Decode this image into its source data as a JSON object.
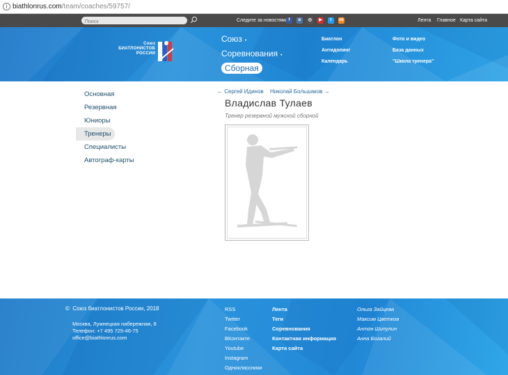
{
  "browser": {
    "url_host": "biathlonrus.com",
    "url_path": "/team/coaches/59757/"
  },
  "topbar": {
    "search_placeholder": "Поиск",
    "follow_label": "Следите за новостями:",
    "social": [
      {
        "icon": "facebook-icon",
        "glyph": "f",
        "color": "#3b5998"
      },
      {
        "icon": "vk-icon",
        "glyph": "в",
        "color": "#4c75a3"
      },
      {
        "icon": "instagram-icon",
        "glyph": "◎",
        "color": "#555555"
      },
      {
        "icon": "youtube-icon",
        "glyph": "▶",
        "color": "#d62e2e"
      },
      {
        "icon": "twitter-icon",
        "glyph": "t",
        "color": "#1da1f2"
      },
      {
        "icon": "odnoklassniki-icon",
        "glyph": "ok",
        "color": "#f28a1d"
      }
    ],
    "links": [
      "Лента",
      "Главное",
      "Карта сайта"
    ]
  },
  "header": {
    "logo_line1": "Союз",
    "logo_line2": "биатлонистов",
    "logo_line3": "России",
    "main_nav": [
      "Союз",
      "Соревнования",
      "Сборная"
    ],
    "sub_col1": [
      "Биатлон",
      "Антидопинг",
      "Календарь"
    ],
    "sub_col2": [
      "Фото и видео",
      "База данных",
      "\"Школа тренера\""
    ]
  },
  "sidebar": {
    "items": [
      "Основная",
      "Резервная",
      "Юниоры",
      "Тренеры",
      "Специалисты",
      "Автограф-карты"
    ],
    "active_index": 3
  },
  "profile": {
    "prev": "Сергей Идинов",
    "next": "Николай Большаков",
    "name": "Владислав Тулаев",
    "role": "Тренер резервной мужской сборной"
  },
  "footer": {
    "copyright": "Союз биатлонистов России, 2018",
    "address": "Москва, Лужнецкая набережная, 8",
    "phone": "Телефон: +7 495 725-46-75",
    "email": "office@biathlonrus.com",
    "social_links": [
      "RSS",
      "Twitter",
      "Facebook",
      "ВКонтакте",
      "Youtube",
      "Instagram",
      "Одноклассники"
    ],
    "site_links": [
      "Лента",
      "Теги",
      "Соревнования",
      "Контактная информация",
      "Карта сайта"
    ],
    "people": [
      "Ольга Зайцева",
      "Максим Цветков",
      "Антон Шипулин",
      "Анна Богалий"
    ]
  }
}
